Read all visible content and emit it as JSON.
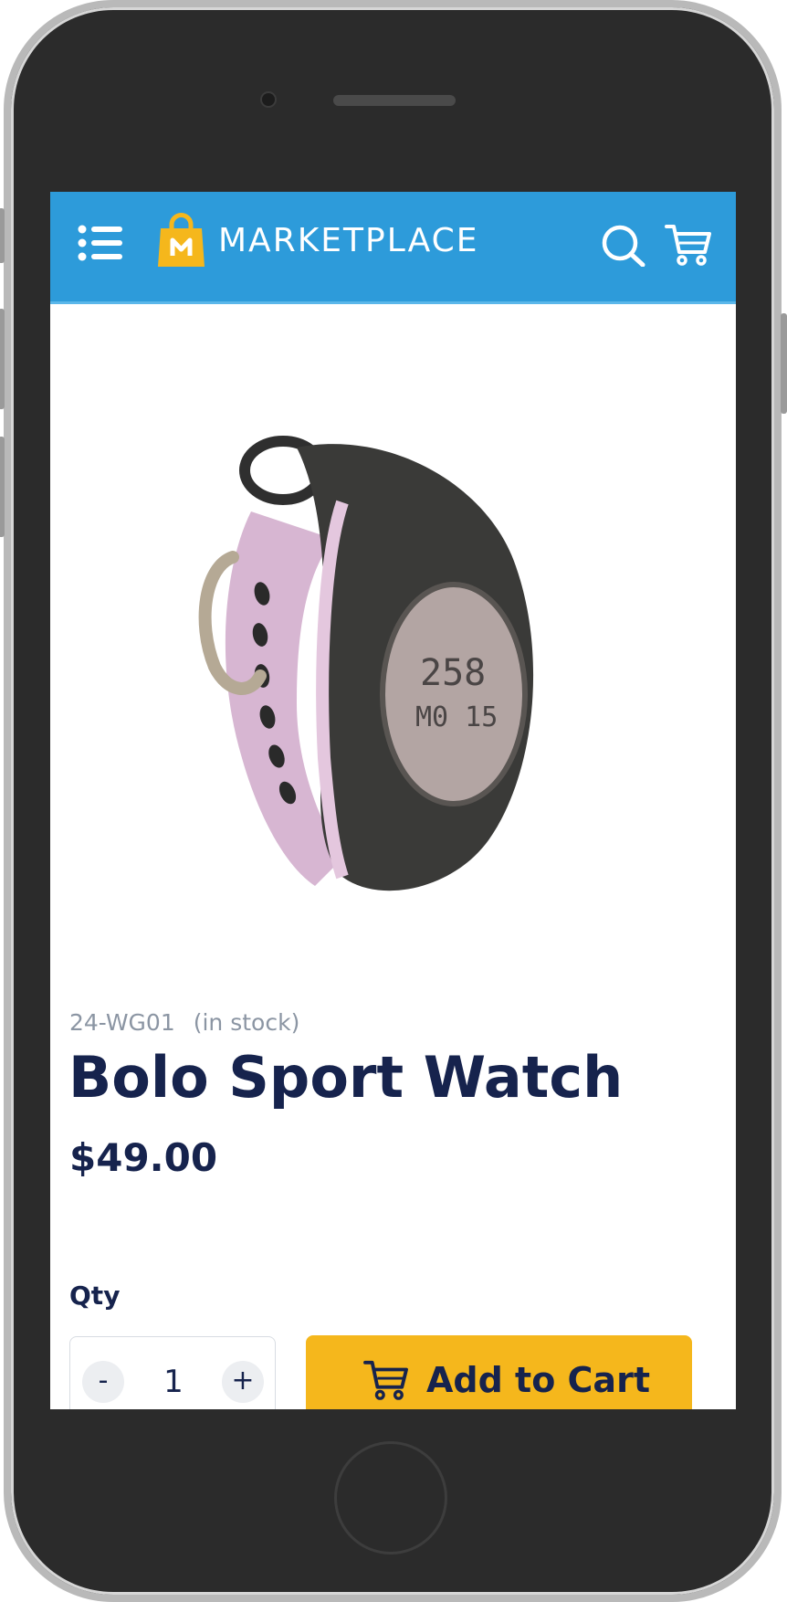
{
  "header": {
    "brand": "MARKETPLACE",
    "colors": {
      "bar": "#2d9bda",
      "logo_bag": "#f5b71c"
    }
  },
  "icons": {
    "menu": "menu-list-icon",
    "search": "search-icon",
    "cart": "cart-icon"
  },
  "product": {
    "sku": "24-WG01",
    "stock_status": "(in stock)",
    "name": "Bolo Sport Watch",
    "price": "$49.00",
    "image_alt": "product-image"
  },
  "purchase": {
    "qty_label": "Qty",
    "qty_minus": "-",
    "qty_value": "1",
    "qty_plus": "+",
    "add_to_cart_label": "Add to Cart",
    "button_color": "#f5b71c"
  }
}
